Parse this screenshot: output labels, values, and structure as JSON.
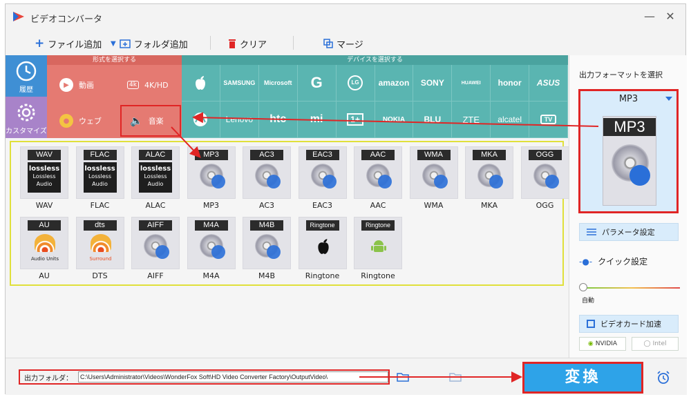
{
  "app": {
    "title": "ビデオコンバータ"
  },
  "toolbar": {
    "add_file": "ファイル追加",
    "add_folder": "フォルダ追加",
    "clear": "クリア",
    "merge": "マージ"
  },
  "side_tabs": [
    {
      "label": "履歴",
      "icon": "history-icon"
    },
    {
      "label": "カスタマイズ",
      "icon": "gear-icon"
    }
  ],
  "format_section": {
    "header": "形式を選択する",
    "buttons": [
      {
        "label": "動画",
        "icon": "play-icon"
      },
      {
        "label": "4K/HD",
        "icon": "4k-icon"
      },
      {
        "label": "ウェブ",
        "icon": "web-icon"
      },
      {
        "label": "音楽",
        "icon": "speaker-icon"
      }
    ]
  },
  "device_section": {
    "header": "デバイスを選択する",
    "brands_row1": [
      "",
      "SAMSUNG",
      "Microsoft",
      "G",
      "LG",
      "amazon",
      "SONY",
      "HUAWEI",
      "honor",
      "ASUS"
    ],
    "brands_row2": [
      "",
      "Lenovo",
      "htc",
      "mi",
      "1+",
      "NOKIA",
      "BLU",
      "ZTE",
      "alcatel",
      "TV"
    ]
  },
  "formats": [
    {
      "tag": "WAV",
      "name": "WAV",
      "kind": "lossless"
    },
    {
      "tag": "FLAC",
      "name": "FLAC",
      "kind": "lossless"
    },
    {
      "tag": "ALAC",
      "name": "ALAC",
      "kind": "lossless"
    },
    {
      "tag": "MP3",
      "name": "MP3",
      "kind": "disc"
    },
    {
      "tag": "AC3",
      "name": "AC3",
      "kind": "disc"
    },
    {
      "tag": "EAC3",
      "name": "EAC3",
      "kind": "disc"
    },
    {
      "tag": "AAC",
      "name": "AAC",
      "kind": "disc"
    },
    {
      "tag": "WMA",
      "name": "WMA",
      "kind": "disc"
    },
    {
      "tag": "MKA",
      "name": "MKA",
      "kind": "disc"
    },
    {
      "tag": "OGG",
      "name": "OGG",
      "kind": "disc"
    },
    {
      "tag": "AU",
      "name": "AU",
      "kind": "audio-units",
      "sub": "Audio Units"
    },
    {
      "tag": "dts",
      "name": "DTS",
      "kind": "dts",
      "sub": "Surround"
    },
    {
      "tag": "AIFF",
      "name": "AIFF",
      "kind": "disc"
    },
    {
      "tag": "M4A",
      "name": "M4A",
      "kind": "disc"
    },
    {
      "tag": "M4B",
      "name": "M4B",
      "kind": "disc"
    },
    {
      "tag": "Ringtone",
      "name": "Ringtone",
      "kind": "apple"
    },
    {
      "tag": "Ringtone",
      "name": "Ringtone",
      "kind": "android"
    }
  ],
  "lossless_text": {
    "logo": "lossless",
    "line1": "Lossless",
    "line2": "Audio"
  },
  "right_panel": {
    "label": "出力フォーマットを選択",
    "selected_format": "MP3",
    "icon_tag": "MP3",
    "param_settings": "パラメータ設定",
    "quick_settings": "クイック設定",
    "auto": "自動",
    "gpu_accel": "ビデオカード加速",
    "nvidia": "NVIDIA",
    "intel": "Intel"
  },
  "bottom": {
    "output_label": "出力フォルダ：",
    "output_path": "C:\\Users\\Administrator\\Videos\\WonderFox Soft\\HD Video Converter Factory\\OutputVideo\\",
    "convert": "変換"
  },
  "colors": {
    "format_red": "#e57a72",
    "device_teal": "#5ab5b1",
    "annotation_red": "#e02525",
    "highlight_yellow": "#e0e03a",
    "convert_blue": "#2ea3e8"
  }
}
